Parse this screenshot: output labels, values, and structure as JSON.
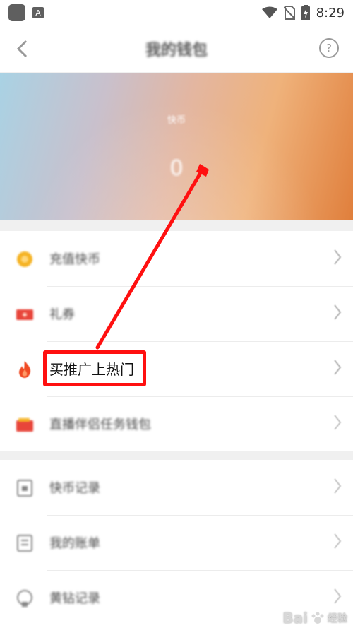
{
  "status_bar": {
    "time": "8:29"
  },
  "header": {
    "title": "我的钱包",
    "help": "?"
  },
  "wallet": {
    "currency_label": "快币",
    "balance": "0"
  },
  "menu_main": [
    {
      "label": "充值快币",
      "icon": "coin-icon"
    },
    {
      "label": "礼券",
      "icon": "ticket-icon"
    },
    {
      "label": "买推广上热门",
      "icon": "fire-icon"
    },
    {
      "label": "直播伴侣任务钱包",
      "icon": "wallet-icon"
    }
  ],
  "menu_records": [
    {
      "label": "快币记录",
      "icon": "coin-record-icon"
    },
    {
      "label": "我的账单",
      "icon": "bill-icon"
    },
    {
      "label": "黄钻记录",
      "icon": "diamond-record-icon"
    }
  ],
  "colors": {
    "accent_red": "#ff1010",
    "coin": "#f5b324",
    "fire": "#f04a23"
  },
  "watermark": {
    "brand": "Bai",
    "suffix": "经验"
  }
}
